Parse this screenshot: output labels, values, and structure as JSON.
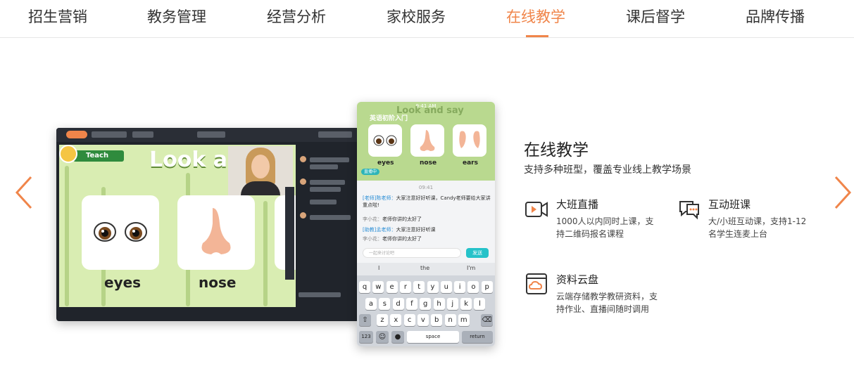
{
  "nav": {
    "tabs": [
      {
        "label": "招生营销"
      },
      {
        "label": "教务管理"
      },
      {
        "label": "经营分析"
      },
      {
        "label": "家校服务"
      },
      {
        "label": "在线教学"
      },
      {
        "label": "课后督学"
      },
      {
        "label": "品牌传播"
      }
    ],
    "active_index": 4
  },
  "colors": {
    "accent": "#f0854a",
    "teal": "#25c2c9",
    "slide_green": "#d9edb2"
  },
  "desktop": {
    "teach_tag": "Teach",
    "slide_title": "Look an",
    "words": [
      "eyes",
      "nose"
    ]
  },
  "phone": {
    "status_time": "9:41 AM",
    "status_battery": "100%",
    "title_overlay": "Look and say",
    "course_title": "英语初阶入门",
    "words": [
      "eyes",
      "nose",
      "ears"
    ],
    "live_tag": "直播中",
    "chat_time": "09:41",
    "messages": [
      {
        "who": "[老师]陈老师：",
        "text": "大家注意好好听课，Candy老师要给大家讲重点啦!"
      },
      {
        "who": "李小花：",
        "text": "老师你讲的太好了"
      },
      {
        "who": "[助教]孟老师：",
        "text": "大家注意好好听课"
      },
      {
        "who": "李小花：",
        "text": "老师你讲的太好了"
      }
    ],
    "input_placeholder": "一起来讨论吧",
    "send_label": "发送",
    "suggestions": [
      "I",
      "the",
      "I'm"
    ],
    "keys_row1": [
      "q",
      "w",
      "e",
      "r",
      "t",
      "y",
      "u",
      "i",
      "o",
      "p"
    ],
    "keys_row2": [
      "a",
      "s",
      "d",
      "f",
      "g",
      "h",
      "j",
      "k",
      "l"
    ],
    "keys_row3": [
      "z",
      "x",
      "c",
      "v",
      "b",
      "n",
      "m"
    ],
    "key_123": "123",
    "key_space": "space",
    "key_return": "return"
  },
  "section": {
    "title": "在线教学",
    "subtitle": "支持多种班型，覆盖专业线上教学场景",
    "features": [
      {
        "icon": "live-video-icon",
        "title": "大班直播",
        "desc": "1000人以内同时上课，支持二维码报名课程"
      },
      {
        "icon": "chat-bubbles-icon",
        "title": "互动班课",
        "desc": "大/小班互动课，支持1-12名学生连麦上台"
      },
      {
        "icon": "cloud-drive-icon",
        "title": "资料云盘",
        "desc": "云端存储教学教研资料，支持作业、直播间随时调用"
      }
    ]
  }
}
